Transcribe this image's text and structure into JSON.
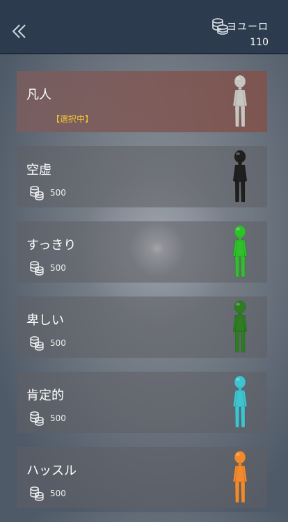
{
  "header": {
    "currency_name": "ヨユーロ",
    "currency_amount": "110"
  },
  "items": [
    {
      "name": "凡人",
      "status": "【選択中】",
      "price": "",
      "color": "#c8c4c0",
      "selected": true
    },
    {
      "name": "空虚",
      "status": "",
      "price": "500",
      "color": "#1f1f1f",
      "selected": false
    },
    {
      "name": "すっきり",
      "status": "",
      "price": "500",
      "color": "#2fc12b",
      "selected": false
    },
    {
      "name": "卑しい",
      "status": "",
      "price": "500",
      "color": "#2e7d23",
      "selected": false
    },
    {
      "name": "肯定的",
      "status": "",
      "price": "500",
      "color": "#3ec4d0",
      "selected": false
    },
    {
      "name": "ハッスル",
      "status": "",
      "price": "500",
      "color": "#f08a2c",
      "selected": false
    }
  ],
  "icons": {
    "back": "double-chevron-left-icon",
    "coin": "coin-stack-icon"
  }
}
